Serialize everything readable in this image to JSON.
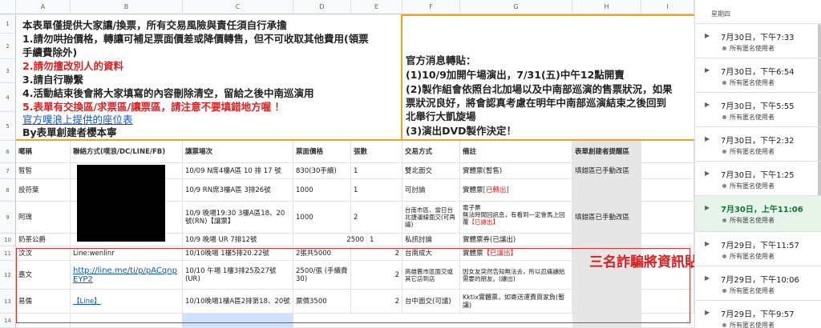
{
  "columns": [
    "A",
    "B",
    "C",
    "D",
    "E",
    "F",
    "G",
    "H",
    "I"
  ],
  "row_numbers": [
    "1",
    "2",
    "3",
    "4",
    "5",
    "6",
    "7",
    "8",
    "9",
    "10",
    "11",
    "12",
    "13",
    "14"
  ],
  "notice_left": [
    {
      "text": "本表單僅提供大家讓/換票，所有交易風險與責任須自行承擔",
      "style": "normal"
    },
    {
      "text": "1.請勿哄抬價格，轉讓可補足票面價差或降價轉售，但不可收取其他費用(領票",
      "style": "normal"
    },
    {
      "text": "手續費除外)",
      "style": "normal"
    },
    {
      "text": "2.請勿擅改別人的資料",
      "style": "red-part"
    },
    {
      "text": "3.請自行聯繫",
      "style": "normal"
    },
    {
      "text": "4.活動結束後會將大家填寫的內容刪除清空，留給之後中南巡演用",
      "style": "normal"
    },
    {
      "text": "5.表單有交換區/求票區/讓票區，請注意不要填錯地方喔 ！",
      "style": "red-part"
    },
    {
      "text": "官方噗浪上提供的座位表",
      "style": "link"
    },
    {
      "text": "By表單創建者櫻本寧",
      "style": "normal"
    }
  ],
  "notice_right": [
    "官方消息轉貼：",
    "(1)10/9加開午場演出，7/31(五)中午12點開賣",
    "(2)製作組會依照台北加場以及中南部巡演的售票狀況，如果",
    "票狀況良好，將會認真考慮在明年中南部巡演結束之後回到",
    "北舉行大凱旋場",
    "(3)演出DVD製作決定！"
  ],
  "table_headers": [
    "暱稱",
    "聯絡方式(噗浪/DC/LINE/FB)",
    "讓票場次",
    "票面價格",
    "張數",
    "交易方式",
    "備註",
    "表單創建者提醒區"
  ],
  "rows": [
    {
      "num": "7",
      "nick": "晳晳",
      "contact": "",
      "session": "10/09 N席4樓A區 10 排 17 號",
      "price": "830(30手續)",
      "qty": "1",
      "trade": "雙北面交",
      "note": "實體票(暫售)",
      "note_red": "",
      "remind": "填錯區已手動改區"
    },
    {
      "num": "8",
      "nick": "設符葉",
      "contact": "",
      "session": "10/9 RN席3樓A區 3排26號",
      "price": "1000",
      "qty": "1",
      "trade": "可討論",
      "note": "實體票",
      "note_red": "[已轉出]",
      "remind": ""
    },
    {
      "num": "9",
      "nick": "阿瑰",
      "contact": "",
      "session": "10/9 晚場19:30 3樓A區18、20號(RN)【讓票】",
      "price": "1000",
      "qty": "2",
      "trade": "台南市區、當日台北捷運線面交(可再議)",
      "note": "電子票\n無法時間回訊息，有看到一定會馬上回覆",
      "note_red": "【已讓出】",
      "remind": "填錯區已手動改區"
    },
    {
      "num": "10",
      "nick": "奶茶公爵",
      "contact": "",
      "session": "10/9 晚場 UR 7排12號",
      "price": "2500",
      "qty": "1",
      "trade": "私訊討論",
      "note": "實體票券(已讓出)",
      "note_red": "",
      "remind": ""
    },
    {
      "num": "11",
      "nick": "汶汶",
      "contact": "Line:wenlinr",
      "session": "10/10晚場 1樓5排20.22號",
      "price": "2張共5000",
      "qty": "2",
      "trade": "台南成大",
      "note": "實體票",
      "note_red": "【已讓出】",
      "remind": ""
    },
    {
      "num": "12",
      "nick": "嘉文",
      "contact": "http://line.me/ti/p/pACqnpEYP2",
      "session": "10/10 午場 1樓3排25及27號(UR)",
      "price": "2500/張 (手續費30)",
      "qty": "2",
      "trade": "高雄舊市區面交或其它店到店",
      "note": "因女友突然告知無法去，所以忍痛讓給需要的朋友。(讓出)",
      "note_red": "",
      "remind": ""
    },
    {
      "num": "13",
      "nick": "易儒",
      "contact": "【Line】",
      "session": "10/10晚場1樓A區2排第18、20號",
      "price": "票價3500",
      "qty": "2",
      "trade": "台中面交(可議)",
      "note": "Kktix實體票，如寄送運費買家負(暫讓)",
      "note_red": "",
      "remind": ""
    }
  ],
  "annotation": "三名詐騙將資訊貼至讓票區",
  "panel": {
    "day_label": "星期四",
    "versions": [
      {
        "when": "7月30日，下午7:33",
        "who": "所有匿名使用者",
        "selected": false
      },
      {
        "when": "7月30日，下午6:54",
        "who": "所有匿名使用者",
        "selected": false
      },
      {
        "when": "7月30日，下午5:55",
        "who": "所有匿名使用者",
        "selected": false
      },
      {
        "when": "7月30日，下午2:32",
        "who": "所有匿名使用者",
        "selected": false
      },
      {
        "when": "7月30日，下午1:25",
        "who": "所有匿名使用者",
        "selected": false
      },
      {
        "when": "7月30日，上午11:06",
        "who": "所有匿名使用者",
        "selected": true
      },
      {
        "when": "7月29日，下午11:57",
        "who": "所有匿名使用者",
        "selected": false
      },
      {
        "when": "7月29日，下午10:06",
        "who": "所有匿名使用者",
        "selected": false
      },
      {
        "when": "7月29日，下午9:57",
        "who": "所有匿名使用者",
        "selected": false
      }
    ]
  },
  "colors": {
    "accent_orange": "#f4a11d",
    "red": "#e02020",
    "selected_green": "#137333",
    "redaction": "#000000"
  }
}
